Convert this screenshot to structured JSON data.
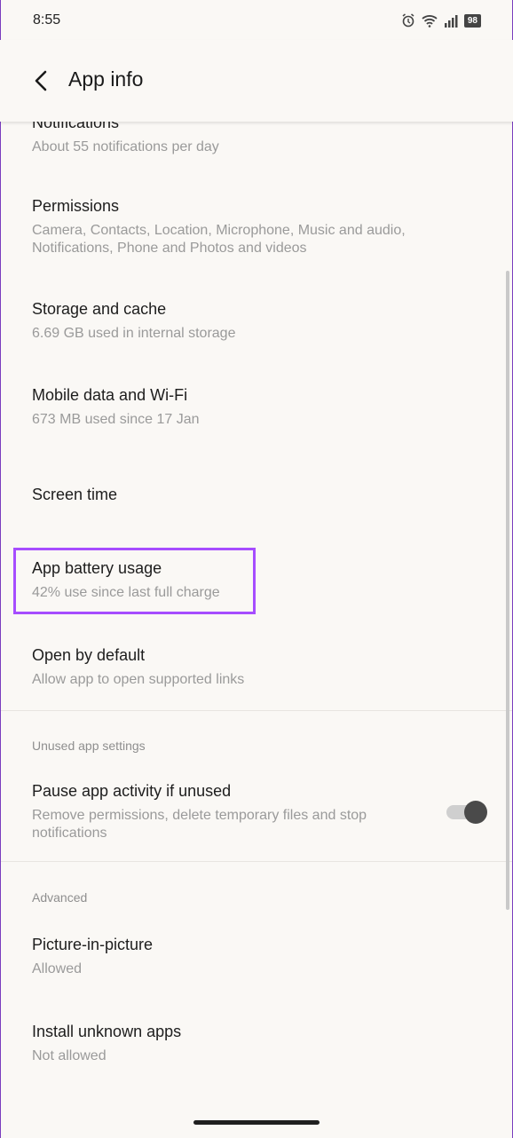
{
  "status": {
    "time": "8:55",
    "battery": "98"
  },
  "appbar": {
    "title": "App info"
  },
  "items": [
    {
      "title": "Notifications",
      "subtitle": "About 55 notifications per day"
    },
    {
      "title": "Permissions",
      "subtitle": "Camera, Contacts, Location, Microphone, Music and audio, Notifications, Phone and Photos and videos"
    },
    {
      "title": "Storage and cache",
      "subtitle": "6.69 GB used in internal storage"
    },
    {
      "title": "Mobile data and Wi-Fi",
      "subtitle": "673 MB used since 17 Jan"
    },
    {
      "title": "Screen time"
    },
    {
      "title": "App battery usage",
      "subtitle": "42% use since last full charge"
    },
    {
      "title": "Open by default",
      "subtitle": "Allow app to open supported links"
    }
  ],
  "unused_section": {
    "label": "Unused app settings",
    "item": {
      "title": "Pause app activity if unused",
      "subtitle": "Remove permissions, delete temporary files and stop notifications",
      "enabled": true
    }
  },
  "advanced_section": {
    "label": "Advanced",
    "items": [
      {
        "title": "Picture-in-picture",
        "subtitle": "Allowed"
      },
      {
        "title": "Install unknown apps",
        "subtitle": "Not allowed"
      }
    ]
  },
  "colors": {
    "accent_highlight": "#a64dff",
    "background": "#faf8f5"
  }
}
